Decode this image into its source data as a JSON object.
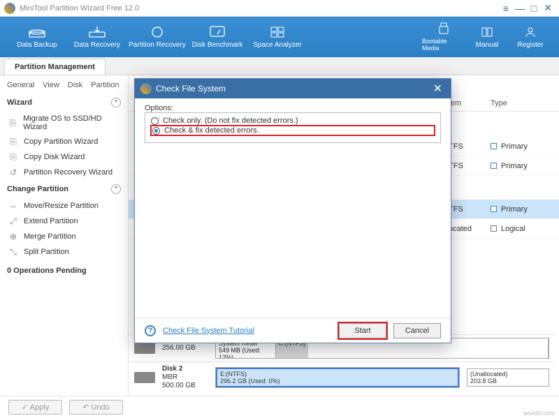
{
  "titlebar": {
    "caption": "MiniTool Partition Wizard Free 12.0"
  },
  "ribbon": {
    "data_backup": "Data Backup",
    "data_recovery": "Data Recovery",
    "partition_recovery": "Partition Recovery",
    "disk_benchmark": "Disk Benchmark",
    "space_analyzer": "Space Analyzer",
    "bootable_media": "Bootable Media",
    "manual": "Manual",
    "register": "Register"
  },
  "tabs": {
    "partition_management": "Partition Management"
  },
  "subtabs": {
    "general": "General",
    "view": "View",
    "disk": "Disk",
    "partition": "Partition"
  },
  "sidebar": {
    "wizard_head": "Wizard",
    "wizard": [
      "Migrate OS to SSD/HD Wizard",
      "Copy Partition Wizard",
      "Copy Disk Wizard",
      "Partition Recovery Wizard"
    ],
    "change_head": "Change Partition",
    "change": [
      "Move/Resize Partition",
      "Extend Partition",
      "Merge Partition",
      "Split Partition"
    ],
    "pending": "0 Operations Pending"
  },
  "grid": {
    "col_fs": "tem",
    "col_type": "Type",
    "rows": [
      {
        "fs": "TFS",
        "type": "Primary",
        "sel": false
      },
      {
        "fs": "TFS",
        "type": "Primary",
        "sel": false
      },
      {
        "fs": "TFS",
        "type": "Primary",
        "sel": true
      },
      {
        "fs": "ocated",
        "type": "Logical",
        "sel": false
      }
    ]
  },
  "disks": {
    "d1": {
      "size": "256.00 GB",
      "seg_label_top": "System Reser",
      "seg_label_bot": "549 MB (Used: 12%)",
      "seg2_top": "C:(NTFS)"
    },
    "d2": {
      "name": "Disk 2",
      "sub": "MBR",
      "size": "500.00 GB",
      "seg_top": "E:(NTFS)",
      "seg_bot": "296.2 GB (Used: 0%)",
      "un_top": "(Unallocated)",
      "un_bot": "203.8 GB"
    }
  },
  "bottom": {
    "apply": "Apply",
    "undo": "Undo"
  },
  "dialog": {
    "title": "Check File System",
    "options_label": "Options:",
    "opt1": "Check only. (Do not fix detected errors.)",
    "opt2": "Check & fix detected errors.",
    "tutorial": "Check File System Tutorial",
    "start": "Start",
    "cancel": "Cancel"
  },
  "watermark": "wsxdn.com"
}
